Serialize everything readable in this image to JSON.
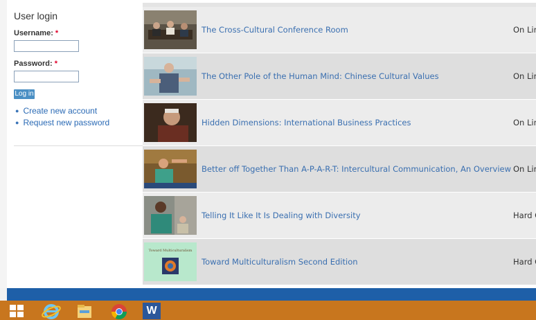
{
  "sidebar": {
    "block_title": "User login",
    "username_label": "Username:",
    "password_label": "Password:",
    "required_mark": "*",
    "username_value": "",
    "password_value": "",
    "login_button": "Log in",
    "links": [
      "Create new account",
      "Request new password"
    ]
  },
  "rows": [
    {
      "title": "The Cross-Cultural Conference Room",
      "status": "On Lin"
    },
    {
      "title": "The Other Pole of the Human Mind: Chinese Cultural Values",
      "status": "On Lin"
    },
    {
      "title": "Hidden Dimensions: International Business Practices",
      "status": "On Lin"
    },
    {
      "title": "Better off Together Than A-P-A-R-T: Intercultural Communication, An Overview",
      "status": "On Lin"
    },
    {
      "title": "Telling It Like It Is Dealing with Diversity",
      "status": "Hard C"
    },
    {
      "title": "Toward Multiculturalism Second Edition",
      "status": "Hard C",
      "thumb_caption": "Toward Multiculturalism"
    }
  ],
  "taskbar": {
    "icons": [
      "windows-start-icon",
      "internet-explorer-icon",
      "file-explorer-icon",
      "chrome-icon",
      "word-icon"
    ],
    "word_letter": "W"
  },
  "colors": {
    "link": "#3a6fb0",
    "footer_bar": "#1e5fa8",
    "taskbar": "#c8761e",
    "login_button": "#4a8fc4"
  }
}
